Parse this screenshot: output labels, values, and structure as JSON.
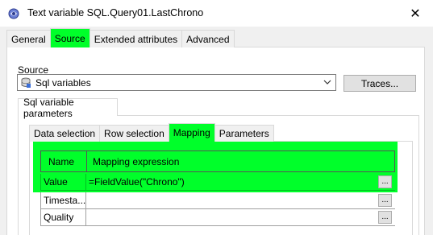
{
  "window": {
    "title": "Text variable SQL.Query01.LastChrono",
    "close_glyph": "✕"
  },
  "main_tabs": [
    {
      "label": "General"
    },
    {
      "label": "Source"
    },
    {
      "label": "Extended attributes"
    },
    {
      "label": "Advanced"
    }
  ],
  "source": {
    "label": "Source",
    "selected": "Sql variables",
    "traces_label": "Traces..."
  },
  "sub_tab": {
    "label": "Sql variable parameters"
  },
  "inner_tabs": [
    {
      "label": "Data selection"
    },
    {
      "label": "Row selection"
    },
    {
      "label": "Mapping"
    },
    {
      "label": "Parameters"
    }
  ],
  "grid": {
    "headers": {
      "name": "Name",
      "expression": "Mapping expression"
    },
    "rows": [
      {
        "name": "Value",
        "expression": "=FieldValue(\"Chrono\")"
      },
      {
        "name": "Timesta...",
        "expression": ""
      },
      {
        "name": "Quality",
        "expression": ""
      }
    ],
    "ellipsis_label": "..."
  },
  "colors": {
    "highlight": "#00ff2a"
  }
}
